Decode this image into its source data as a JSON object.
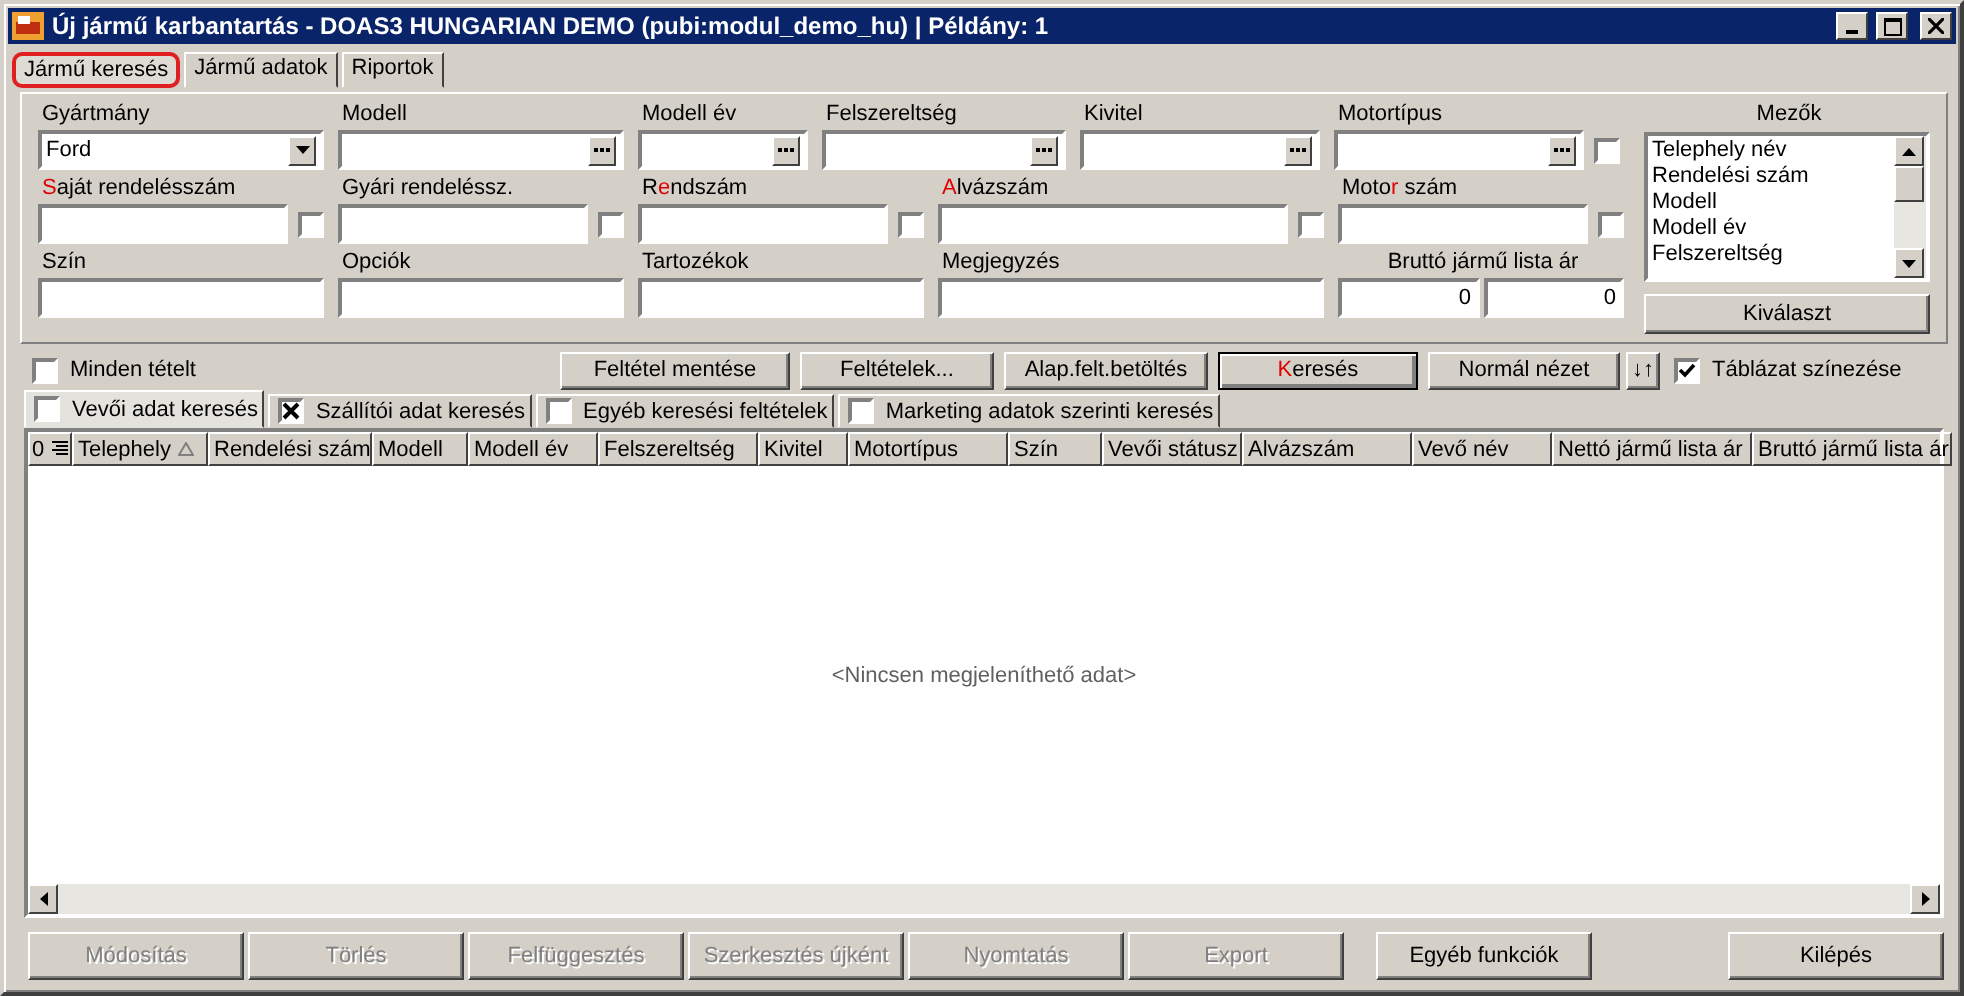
{
  "window": {
    "title": "Új jármű karbantartás - DOAS3 HUNGARIAN DEMO (pubi:modul_demo_hu) | Példány: 1"
  },
  "tabs": [
    {
      "label": "Jármű keresés",
      "selected": true,
      "highlighted": true
    },
    {
      "label": "Jármű adatok",
      "selected": false,
      "highlighted": false
    },
    {
      "label": "Riportok",
      "selected": false,
      "highlighted": false
    }
  ],
  "form": {
    "rows": [
      [
        {
          "label": "Gyártmány",
          "kind": "combo",
          "value": "Ford"
        },
        {
          "label": "Modell",
          "kind": "lookup"
        },
        {
          "label": "Modell év",
          "kind": "lookup"
        },
        {
          "label": "Felszereltség",
          "kind": "lookup"
        },
        {
          "label": "Kivitel",
          "kind": "lookup"
        },
        {
          "label": "Motortípus",
          "kind": "lookup",
          "checkbox": {
            "checked": false
          }
        }
      ],
      [
        {
          "label": [
            {
              "text": "S",
              "accent": true
            },
            {
              "text": "aját rendelésszám",
              "accent": false
            }
          ],
          "kind": "text",
          "checkbox": {
            "checked": false
          }
        },
        {
          "label": "Gyári rendeléssz.",
          "kind": "text",
          "checkbox": {
            "checked": false
          }
        },
        {
          "label": [
            {
              "text": "R",
              "accent": false
            },
            {
              "text": "e",
              "accent": true
            },
            {
              "text": "ndszám",
              "accent": false
            }
          ],
          "kind": "text",
          "checkbox": {
            "checked": false
          }
        },
        {
          "label": [
            {
              "text": "A",
              "accent": true
            },
            {
              "text": "lvázszám",
              "accent": false
            }
          ],
          "kind": "text",
          "checkbox": {
            "checked": false
          }
        },
        {
          "label": [
            {
              "text": "Moto",
              "accent": false
            },
            {
              "text": "r",
              "accent": true
            },
            {
              "text": " szám",
              "accent": false
            }
          ],
          "kind": "text",
          "checkbox": {
            "checked": false
          }
        }
      ],
      [
        {
          "label": "Szín",
          "kind": "text"
        },
        {
          "label": "Opciók",
          "kind": "text"
        },
        {
          "label": "Tartozékok",
          "kind": "text"
        },
        {
          "label": "Megjegyzés",
          "kind": "text"
        },
        {
          "label": "Bruttó jármű lista ár",
          "kind": "range",
          "values": [
            "0",
            "0"
          ]
        }
      ]
    ],
    "fields_list": {
      "title": "Mezők",
      "items": [
        "Telephely név",
        "Rendelési szám",
        "Modell",
        "Modell év",
        "Felszereltség"
      ],
      "button": "Kiválaszt"
    }
  },
  "toolbar": {
    "all_items": {
      "label": "Minden tételt",
      "checked": false
    },
    "buttons": [
      {
        "label": [
          {
            "text": "Feltétel mentése",
            "accent": false
          }
        ],
        "default": false
      },
      {
        "label": [
          {
            "text": "Feltételek...",
            "accent": false
          }
        ],
        "default": false
      },
      {
        "label": [
          {
            "text": "Alap.felt.betöltés",
            "accent": false
          }
        ],
        "default": false
      },
      {
        "label": [
          {
            "text": "K",
            "accent": true
          },
          {
            "text": "eresés",
            "accent": false
          }
        ],
        "default": true
      },
      {
        "label": [
          {
            "text": "Normál nézet",
            "accent": false
          }
        ],
        "default": false
      }
    ],
    "sort_button": "↓↑",
    "coloring": {
      "label": "Táblázat színezése",
      "checked": true
    }
  },
  "search_tabs": [
    {
      "label": "Vevői adat keresés",
      "checked": false,
      "selected": true
    },
    {
      "label": "Szállítói adat keresés",
      "checked": true,
      "selected": false
    },
    {
      "label": "Egyéb keresési feltételek",
      "checked": false,
      "selected": false
    },
    {
      "label": "Marketing adatok szerinti keresés",
      "checked": false,
      "selected": false
    }
  ],
  "table": {
    "corner": "0",
    "columns": [
      {
        "label": "Telephely",
        "sorted": true
      },
      {
        "label": "Rendelési szám",
        "sorted": false
      },
      {
        "label": "Modell",
        "sorted": false
      },
      {
        "label": "Modell év",
        "sorted": false
      },
      {
        "label": "Felszereltség",
        "sorted": false
      },
      {
        "label": "Kivitel",
        "sorted": false
      },
      {
        "label": "Motortípus",
        "sorted": false
      },
      {
        "label": "Szín",
        "sorted": false
      },
      {
        "label": "Vevői státusz",
        "sorted": false
      },
      {
        "label": "Alvázszám",
        "sorted": false
      },
      {
        "label": "Vevő név",
        "sorted": false
      },
      {
        "label": "Nettó jármű lista ár",
        "sorted": false
      },
      {
        "label": "Bruttó jármű lista ár",
        "sorted": false
      }
    ],
    "empty_message": "<Nincsen megjeleníthető adat>"
  },
  "bottom_buttons": [
    {
      "label": "Módosítás",
      "disabled": true
    },
    {
      "label": "Törlés",
      "disabled": true
    },
    {
      "label": "Felfüggesztés",
      "disabled": true
    },
    {
      "label": "Szerkesztés újként",
      "disabled": true
    },
    {
      "label": "Nyomtatás",
      "disabled": true
    },
    {
      "label": "Export",
      "disabled": true
    },
    {
      "label": "Egyéb funkciók",
      "disabled": false
    },
    {
      "label": "Kilépés",
      "disabled": false
    }
  ]
}
